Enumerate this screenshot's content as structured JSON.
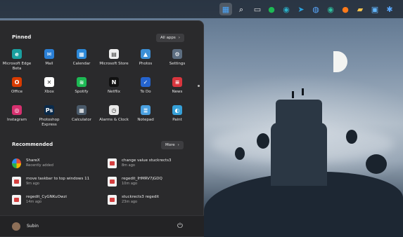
{
  "taskbar": {
    "icons": [
      {
        "name": "start-icon",
        "glyph": "▦",
        "color": "#4aa8ff",
        "active": true
      },
      {
        "name": "search-icon",
        "glyph": "⌕",
        "color": "#ffffff"
      },
      {
        "name": "task-view-icon",
        "glyph": "▭",
        "color": "#dddddd"
      },
      {
        "name": "spotify-icon",
        "glyph": "●",
        "color": "#1db954"
      },
      {
        "name": "edge-icon",
        "glyph": "◉",
        "color": "#2bb0c9"
      },
      {
        "name": "telegram-icon",
        "glyph": "➤",
        "color": "#2aa3e0"
      },
      {
        "name": "wifi-app-icon",
        "glyph": "◍",
        "color": "#5aa9ff"
      },
      {
        "name": "edge-beta-icon",
        "glyph": "◉",
        "color": "#2fc0a0"
      },
      {
        "name": "firefox-icon",
        "glyph": "●",
        "color": "#ff7a1a"
      },
      {
        "name": "file-explorer-icon",
        "glyph": "▰",
        "color": "#f2c14e"
      },
      {
        "name": "photos-icon",
        "glyph": "▣",
        "color": "#62b7ff"
      },
      {
        "name": "settings-gear-icon",
        "glyph": "✱",
        "color": "#5aa9ff"
      }
    ]
  },
  "start_menu": {
    "pinned_title": "Pinned",
    "all_apps_label": "All apps",
    "pinned_apps": [
      {
        "label": "Microsoft Edge Beta",
        "icon": "edge-beta-icon",
        "glyph": "e",
        "color": "#1aa0a0"
      },
      {
        "label": "Mail",
        "icon": "mail-icon",
        "glyph": "✉",
        "color": "#2a7fd6"
      },
      {
        "label": "Calendar",
        "icon": "calendar-icon",
        "glyph": "▦",
        "color": "#2b88d8"
      },
      {
        "label": "Microsoft Store",
        "icon": "store-icon",
        "glyph": "▤",
        "color": "#f0f0f0"
      },
      {
        "label": "Photos",
        "icon": "photos-icon",
        "glyph": "▲",
        "color": "#3c8fd6"
      },
      {
        "label": "Settings",
        "icon": "settings-icon",
        "glyph": "⚙",
        "color": "#5c6d80"
      },
      {
        "label": "Office",
        "icon": "office-icon",
        "glyph": "O",
        "color": "#d83b01"
      },
      {
        "label": "Xbox",
        "icon": "xbox-icon",
        "glyph": "✕",
        "color": "#ffffff"
      },
      {
        "label": "Spotify",
        "icon": "spotify-icon",
        "glyph": "≋",
        "color": "#1db954"
      },
      {
        "label": "Netflix",
        "icon": "netflix-icon",
        "glyph": "N",
        "color": "#111111"
      },
      {
        "label": "To Do",
        "icon": "todo-icon",
        "glyph": "✓",
        "color": "#2564cf"
      },
      {
        "label": "News",
        "icon": "news-icon",
        "glyph": "≡",
        "color": "#d9363e"
      },
      {
        "label": "Instagram",
        "icon": "instagram-icon",
        "glyph": "◎",
        "color": "#d6306f"
      },
      {
        "label": "Photoshop Express",
        "icon": "photoshop-icon",
        "glyph": "Ps",
        "color": "#0a2a4a"
      },
      {
        "label": "Calculator",
        "icon": "calculator-icon",
        "glyph": "▦",
        "color": "#4a5a6a"
      },
      {
        "label": "Alarms & Clock",
        "icon": "clock-icon",
        "glyph": "◷",
        "color": "#e8e8e8"
      },
      {
        "label": "Notepad",
        "icon": "notepad-icon",
        "glyph": "≣",
        "color": "#4aa0e0"
      },
      {
        "label": "Paint",
        "icon": "paint-icon",
        "glyph": "◐",
        "color": "#36a0d8"
      }
    ],
    "recommended_title": "Recommended",
    "more_label": "More",
    "recommended": [
      {
        "name": "ShareX",
        "time": "Recently added",
        "icon": "sharex-icon"
      },
      {
        "name": "change value stuckrects3",
        "time": "8m ago",
        "icon": "reg-file-icon"
      },
      {
        "name": "move taskbar to top windows 11",
        "time": "9m ago",
        "icon": "reg-file-icon"
      },
      {
        "name": "regedit_lHMRV7jGDQ",
        "time": "10m ago",
        "icon": "reg-file-icon"
      },
      {
        "name": "regedit_CyGNKuOwzi",
        "time": "14m ago",
        "icon": "reg-file-icon"
      },
      {
        "name": "stuckrects3 regedit",
        "time": "23m ago",
        "icon": "reg-file-icon"
      }
    ],
    "user_name": "Subin"
  }
}
